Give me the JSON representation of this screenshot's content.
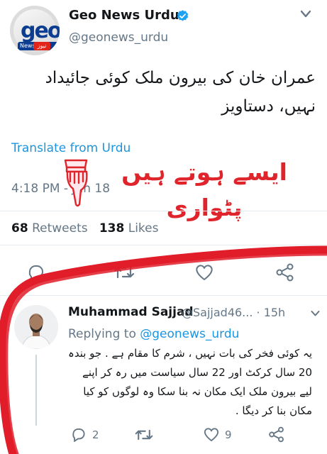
{
  "tweet": {
    "display_name": "Geo News Urdu",
    "handle": "@geonews_urdu",
    "avatar_logo": "geo",
    "avatar_logo_band_en": "News",
    "avatar_logo_band_ur": "نیوز",
    "text": "عمران خان کی بیرون ملک کوئی جائیداد نہیں، دستاویز",
    "translate_link": "Translate from Urdu",
    "time": "4:18 PM - Jun 18",
    "retweets_count": "68",
    "retweets_label": "Retweets",
    "likes_count": "138",
    "likes_label": "Likes"
  },
  "overlay_annotation": "ایسے ہوتے ہیں پٹواری",
  "reply": {
    "display_name": "Muhammad Sajjad",
    "handle": "@Sajjad46... · 15h",
    "replying_prefix": "Replying to ",
    "replying_handle": "@geonews_urdu",
    "text": "یہ کوئی فخر کی بات نہیں ، شرم کا مقام ہے . جو بندہ 20 سال کرکٹ اور 22 سال سیاست میں رہ کر اپنے لیے بیرون ملک ایک مکان نہ بنا سکا وہ لوگوں کو کیا مکان بنا کر دیگا .",
    "reply_count": "2",
    "like_count": "9"
  },
  "colors": {
    "link": "#1b95e0",
    "muted": "#657786",
    "annotation_red": "#e0242c",
    "verified": "#1da1f2"
  }
}
